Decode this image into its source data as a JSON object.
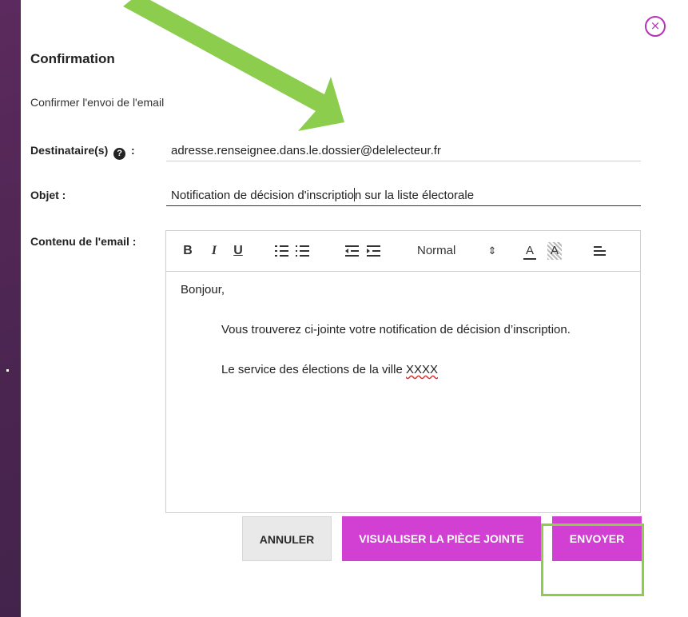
{
  "dialog": {
    "title": "Confirmation",
    "subtitle": "Confirmer l'envoi de l'email",
    "close_icon": "×"
  },
  "fields": {
    "recipients_label": "Destinataire(s)",
    "recipients_help": "?",
    "recipients_colon": ":",
    "recipients_value": "adresse.renseignee.dans.le.dossier@delelecteur.fr",
    "subject_label": "Objet :",
    "subject_value_before_caret": "Notification de décision d'inscriptio",
    "subject_value_after_caret": "n sur la liste électorale",
    "content_label": "Contenu de l'email :"
  },
  "toolbar": {
    "bold": "B",
    "italic": "I",
    "underline": "U",
    "format_select": "Normal",
    "format_select_arrows": "⇕",
    "font_color": "A",
    "background_color": "A",
    "icons": [
      "bold-icon",
      "italic-icon",
      "underline-icon",
      "ordered-list-icon",
      "bullet-list-icon",
      "outdent-icon",
      "indent-icon",
      "font-color-icon",
      "background-color-icon",
      "align-icon"
    ]
  },
  "email_body": {
    "greeting": "Bonjour,",
    "line1": "Vous trouverez ci-jointe votre notification de décision d’inscription.",
    "line2_prefix": "Le service des élections de la ville ",
    "line2_placeholder": "XXXX"
  },
  "actions": {
    "cancel_label": "ANNULER",
    "preview_label": "VISUALISER LA PIÈCE JOINTE",
    "send_label": "ENVOYER"
  },
  "colors": {
    "accent": "#d13fd3",
    "annotation_green": "#8ccd4e",
    "background": "#4a2550"
  }
}
